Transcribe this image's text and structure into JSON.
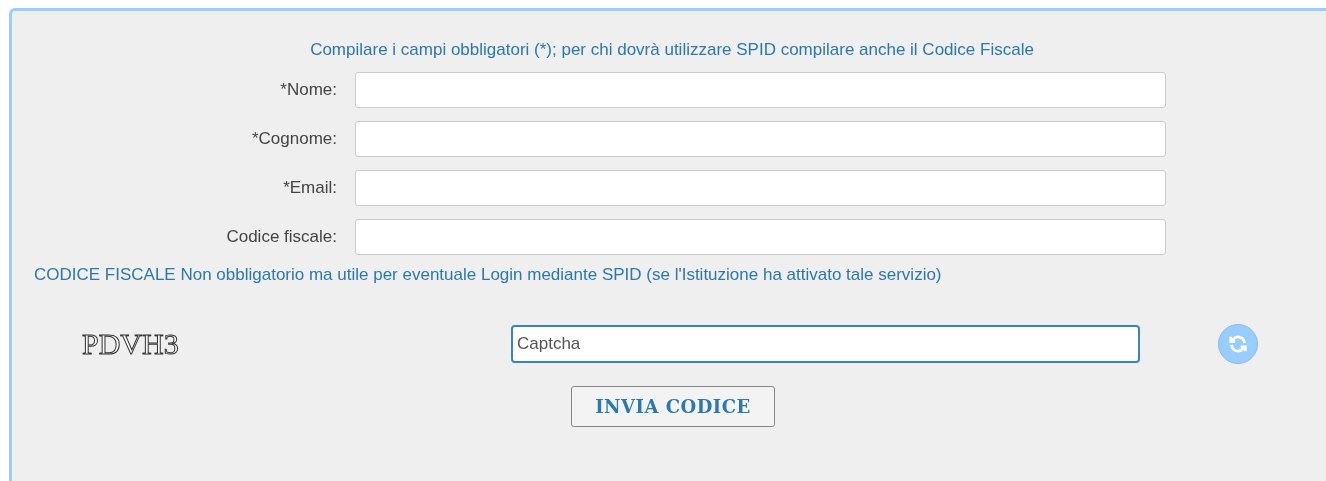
{
  "form": {
    "instructions": "Compilare i campi obbligatori (*); per chi dovrà utilizzare SPID compilare anche il Codice Fiscale",
    "fields": [
      {
        "label": "*Nome:"
      },
      {
        "label": "*Cognome:"
      },
      {
        "label": "*Email:"
      },
      {
        "label": "Codice fiscale:"
      }
    ],
    "note": "CODICE FISCALE Non obbligatorio ma utile per eventuale Login mediante SPID (se l'Istituzione ha attivato tale servizio)",
    "captcha": {
      "code": "PDVH3",
      "value": "Captcha"
    },
    "submit": "INVIA CODICE"
  }
}
